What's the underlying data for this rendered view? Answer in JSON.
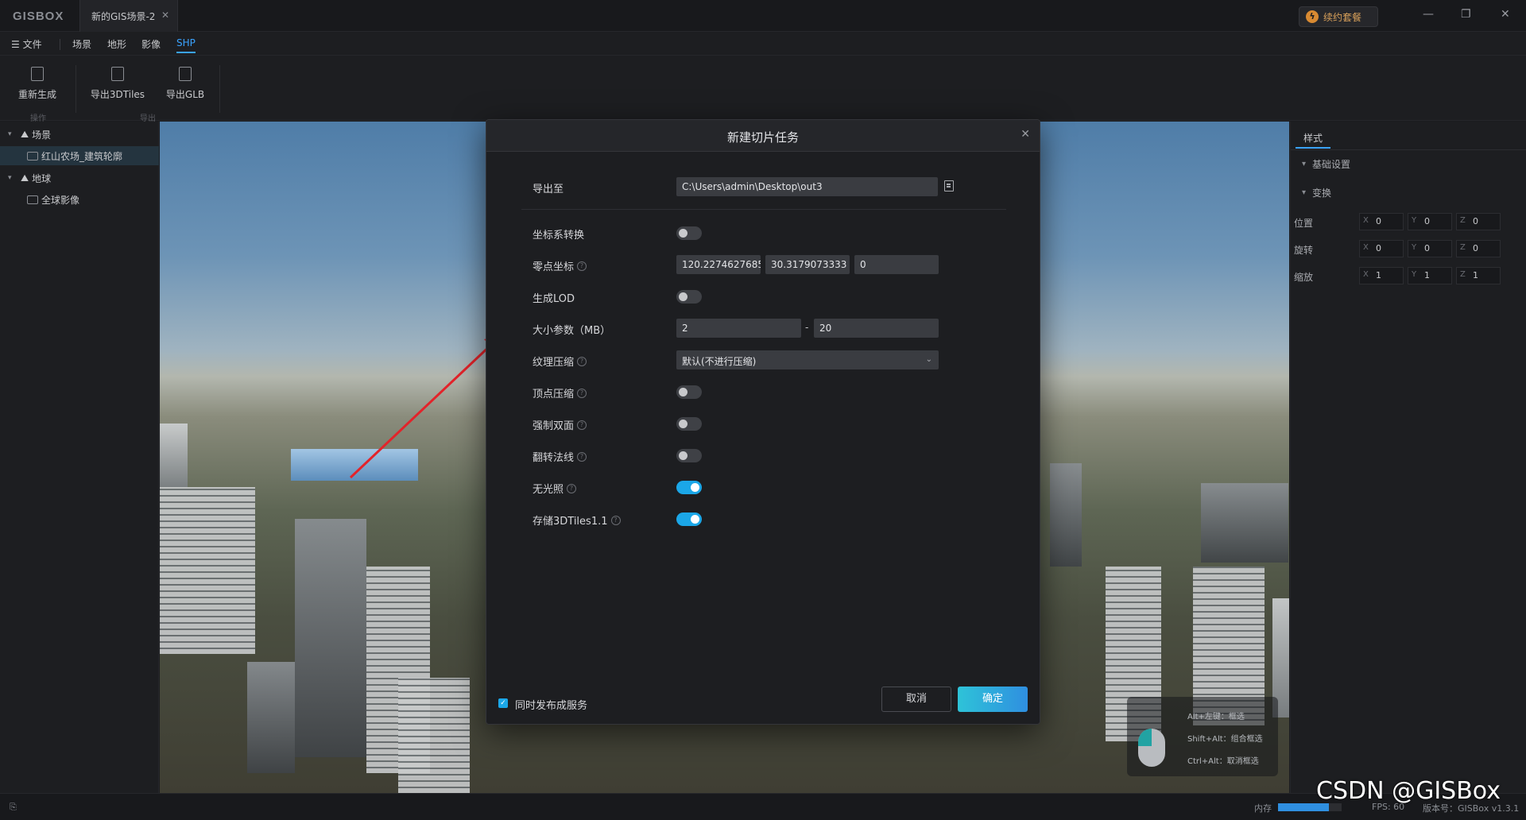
{
  "app": {
    "logo": "GISBOX",
    "doc_tab": "新的GIS场景-2",
    "renew_label": "续约套餐"
  },
  "menu": {
    "file": "文件",
    "items": [
      "场景",
      "地形",
      "影像",
      "SHP"
    ],
    "active": "SHP"
  },
  "ribbon": {
    "buttons": [
      {
        "label": "重新生成",
        "icon": "regenerate-icon"
      },
      {
        "label": "导出3DTiles",
        "icon": "export-icon"
      },
      {
        "label": "导出GLB",
        "icon": "export-icon"
      }
    ],
    "groups": [
      "操作",
      "导出"
    ]
  },
  "tree": {
    "scene": "场景",
    "scene_child": "红山农场_建筑轮廓",
    "globe": "地球",
    "globe_child": "全球影像"
  },
  "right_panel": {
    "tab": "样式",
    "section_basic": "基础设置",
    "section_transform": "变换",
    "rows": [
      {
        "label": "位置",
        "x": "0",
        "y": "0",
        "z": "0"
      },
      {
        "label": "旋转",
        "x": "0",
        "y": "0",
        "z": "0"
      },
      {
        "label": "缩放",
        "x": "1",
        "y": "1",
        "z": "1"
      }
    ]
  },
  "modal": {
    "title": "新建切片任务",
    "export_label": "导出至",
    "export_path": "C:\\Users\\admin\\Desktop\\out3",
    "coord_transform_label": "坐标系转换",
    "coord_transform_on": false,
    "origin_label": "零点坐标",
    "origin_x": "120.2274627685",
    "origin_y": "30.3179073333",
    "origin_z": "0",
    "lod_label": "生成LOD",
    "lod_on": false,
    "size_label": "大小参数（MB）",
    "size_min": "2",
    "size_dash": "-",
    "size_max": "20",
    "texture_label": "纹理压缩",
    "texture_value": "默认(不进行压缩)",
    "vertex_label": "顶点压缩",
    "vertex_on": false,
    "double_side_label": "强制双面",
    "double_side_on": false,
    "flip_normal_label": "翻转法线",
    "flip_normal_on": false,
    "no_light_label": "无光照",
    "no_light_on": true,
    "tiles11_label": "存储3DTiles1.1",
    "tiles11_on": true,
    "publish_label": "同时发布成服务",
    "publish_checked": true,
    "cancel": "取消",
    "ok": "确定"
  },
  "mouse_hint": {
    "line1": "Alt+左键：框选",
    "line2": "Shift+Alt：组合框选",
    "line3": "Ctrl+Alt：取消框选"
  },
  "status": {
    "memory_label": "内存",
    "memory_fraction": 0.8,
    "fps": "FPS: 60",
    "version": "版本号：GISBox v1.3.1"
  },
  "watermark": "CSDN @GISBox",
  "colors": {
    "accent": "#3aa3ff",
    "toggle_on": "#1ba7e8",
    "highlight": "#e3232a"
  }
}
